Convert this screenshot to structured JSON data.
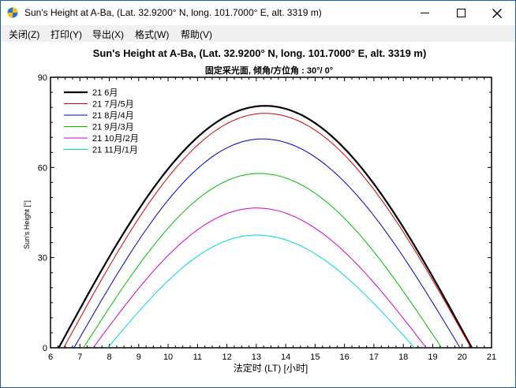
{
  "window": {
    "title": "Sun's Height at A-Ba, (Lat. 32.9200° N, long. 101.7000° E, alt. 3319 m)"
  },
  "menu": {
    "items": [
      "关闭(Z)",
      "打印(Y)",
      "导出(X)",
      "格式(W)",
      "帮助(V)"
    ]
  },
  "chart_data": {
    "type": "line",
    "title": "Sun's Height at A-Ba, (Lat. 32.9200° N, long. 101.7000° E, alt. 3319 m)",
    "subtitle": "固定采光面, 倾角/方位角 : 30°/ 0°",
    "xlabel": "法定时 (LT) [小时]",
    "ylabel": "Sun's Height [°]",
    "xlim": [
      6,
      21
    ],
    "ylim": [
      0,
      90
    ],
    "xticks": [
      "6",
      "7",
      "8",
      "9",
      "10",
      "11",
      "12",
      "13",
      "14",
      "15",
      "16",
      "17",
      "18",
      "19",
      "20",
      "21"
    ],
    "yticks": [
      "0",
      "30",
      "60",
      "90"
    ],
    "grid": false,
    "legend_position": "top-left",
    "series": [
      {
        "name": "21 6月",
        "color": "#000000",
        "width": 2.2,
        "rise": 6.28,
        "set": 20.33,
        "noon": 13.3,
        "peak": 80.5
      },
      {
        "name": "21 7月/5月",
        "color": "#d40000",
        "width": 1,
        "rise": 6.45,
        "set": 20.3,
        "noon": 13.3,
        "peak": 78
      },
      {
        "name": "21 8月/4月",
        "color": "#0000c8",
        "width": 1,
        "rise": 6.8,
        "set": 19.93,
        "noon": 13.2,
        "peak": 69.5
      },
      {
        "name": "21 9月/3月",
        "color": "#00c000",
        "width": 1,
        "rise": 7.12,
        "set": 19.3,
        "noon": 13.1,
        "peak": 58
      },
      {
        "name": "21 10月/2月",
        "color": "#d400d4",
        "width": 1,
        "rise": 7.45,
        "set": 18.78,
        "noon": 13.0,
        "peak": 46.5
      },
      {
        "name": "21 11月/1月",
        "color": "#00d8d8",
        "width": 1,
        "rise": 7.95,
        "set": 18.38,
        "noon": 13.0,
        "peak": 37.5
      }
    ]
  }
}
